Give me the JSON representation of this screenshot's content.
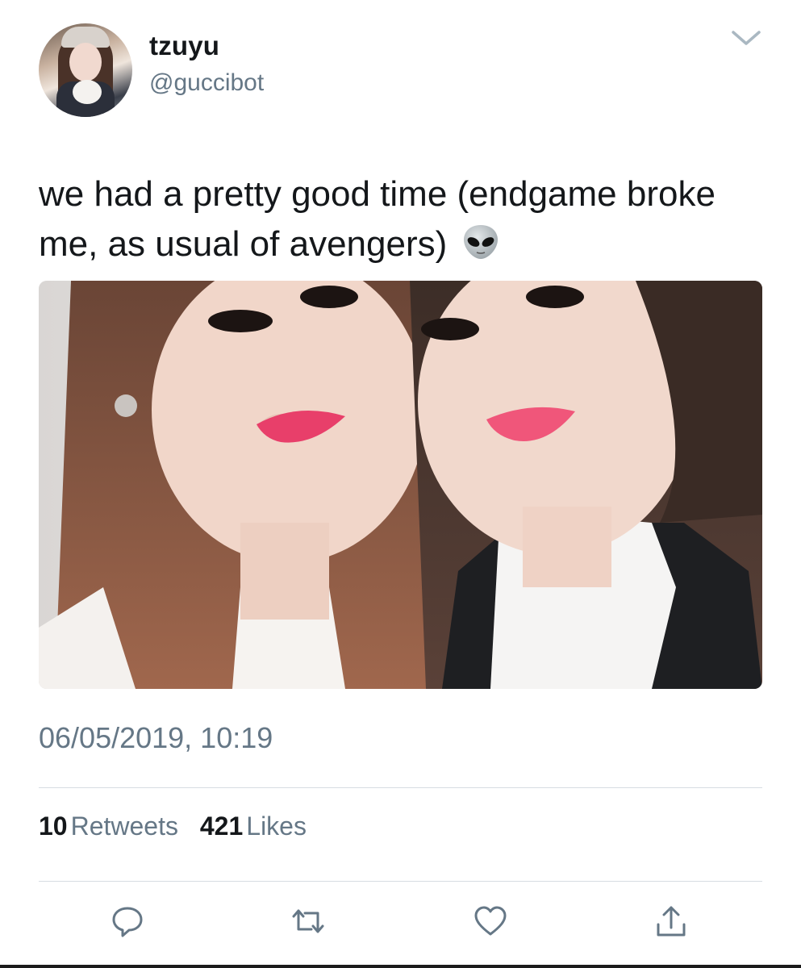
{
  "user": {
    "display_name": "tzuyu",
    "handle": "@guccibot"
  },
  "tweet": {
    "text": "we had a pretty good time (endgame broke me, as usual of avengers)",
    "emoji": "alien-emoji",
    "timestamp": "06/05/2019, 10:19"
  },
  "stats": {
    "retweets_count": "10",
    "retweets_label": "Retweets",
    "likes_count": "421",
    "likes_label": "Likes"
  },
  "icons": {
    "menu": "chevron-down-icon",
    "reply": "reply-icon",
    "retweet": "retweet-icon",
    "like": "heart-icon",
    "share": "share-icon"
  },
  "colors": {
    "text": "#14171a",
    "secondary": "#657786",
    "divider": "#d7dde2"
  }
}
